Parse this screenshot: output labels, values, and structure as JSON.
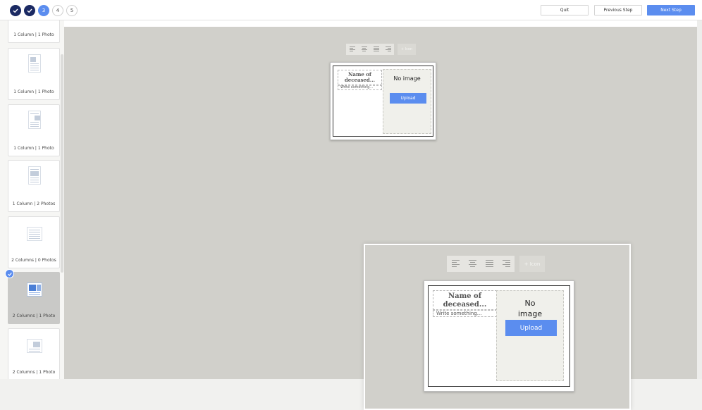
{
  "steps": [
    {
      "label": "",
      "state": "done"
    },
    {
      "label": "",
      "state": "done"
    },
    {
      "label": "3",
      "state": "current"
    },
    {
      "label": "4",
      "state": "todo"
    },
    {
      "label": "5",
      "state": "todo"
    }
  ],
  "header": {
    "quit_label": "Quit",
    "previous_label": "Previous Step",
    "next_label": "Next Step"
  },
  "sidebar": {
    "items": [
      {
        "label": "1 Column | 1 Photo"
      },
      {
        "label": "1 Column | 1 Photo"
      },
      {
        "label": "1 Column | 1 Photo"
      },
      {
        "label": "1 Column | 2 Photos"
      },
      {
        "label": "2 Columns | 0 Photos"
      },
      {
        "label": "2 Columns | 1 Photo",
        "selected": true
      },
      {
        "label": "2 Columns | 1 Photo"
      }
    ]
  },
  "editor": {
    "icon_button_label": "+ Icon",
    "name_placeholder": "Name of deceased...",
    "write_placeholder": "Write something...",
    "no_image_text": "No image",
    "upload_label": "Upload"
  },
  "colors": {
    "accent": "#5b8def",
    "done_step": "#1b2a63",
    "canvas": "#d1d0cb"
  }
}
